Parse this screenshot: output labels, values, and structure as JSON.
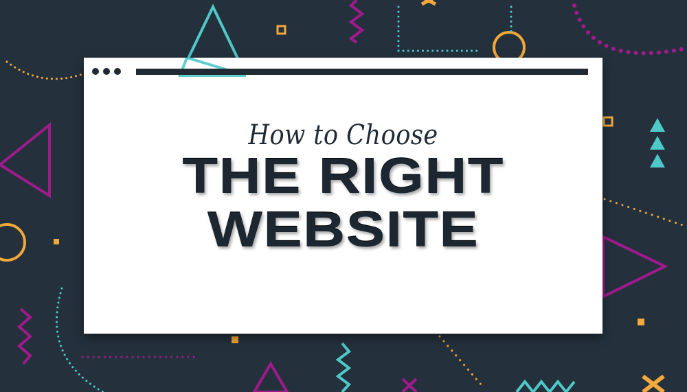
{
  "hero": {
    "kicker": "How to Choose",
    "title_lines": [
      "THE RIGHT",
      "WEBSITE"
    ]
  },
  "colors": {
    "background": "#24313d",
    "card": "#ffffff",
    "ink": "#1c2731",
    "teal": "#4fc8c8",
    "magenta": "#a01a8c",
    "orange": "#f3a83b"
  },
  "icons": [
    "window-control-dots",
    "address-bar",
    "triangle-shapes",
    "circle-shapes",
    "zigzag-shapes",
    "cross-shapes"
  ]
}
